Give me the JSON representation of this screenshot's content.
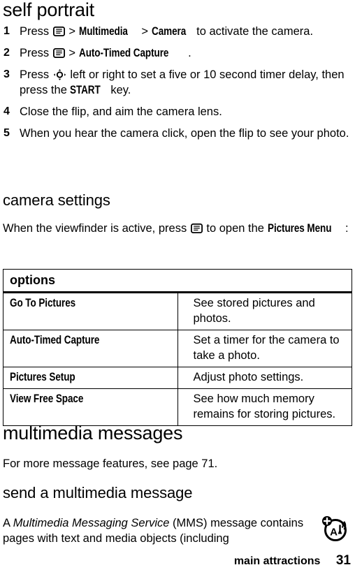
{
  "sections": {
    "self_portrait": {
      "heading": "self portrait",
      "steps": [
        {
          "num": "1",
          "parts": [
            {
              "t": "text",
              "v": "Press "
            },
            {
              "t": "icon",
              "v": "menu-key-icon"
            },
            {
              "t": "text",
              "v": " > "
            },
            {
              "t": "ui",
              "v": "Multimedia"
            },
            {
              "t": "text",
              "v": " > "
            },
            {
              "t": "ui",
              "v": "Camera"
            },
            {
              "t": "text",
              "v": " to activate the camera."
            }
          ]
        },
        {
          "num": "2",
          "parts": [
            {
              "t": "text",
              "v": "Press "
            },
            {
              "t": "icon",
              "v": "menu-key-icon"
            },
            {
              "t": "text",
              "v": " > "
            },
            {
              "t": "ui",
              "v": "Auto-Timed Capture"
            },
            {
              "t": "text",
              "v": "."
            }
          ]
        },
        {
          "num": "3",
          "parts": [
            {
              "t": "text",
              "v": "Press "
            },
            {
              "t": "navicon",
              "v": "navigation-key-icon"
            },
            {
              "t": "text",
              "v": " left or right to set a five or 10 second timer delay, then press the "
            },
            {
              "t": "ui",
              "v": "START"
            },
            {
              "t": "text",
              "v": " key."
            }
          ]
        },
        {
          "num": "4",
          "parts": [
            {
              "t": "text",
              "v": "Close the flip, and aim the camera lens."
            }
          ]
        },
        {
          "num": "5",
          "parts": [
            {
              "t": "text",
              "v": "When you hear the camera click, open the flip to see your photo."
            }
          ]
        }
      ]
    },
    "camera_settings": {
      "heading": "camera settings",
      "intro": [
        {
          "t": "text",
          "v": "When the viewfinder is active, press "
        },
        {
          "t": "icon",
          "v": "menu-key-icon"
        },
        {
          "t": "text",
          "v": " to open the "
        },
        {
          "t": "ui",
          "v": "Pictures Menu"
        },
        {
          "t": "text",
          "v": ":"
        }
      ],
      "table": {
        "header": "options",
        "rows": [
          {
            "option": "Go To Pictures",
            "description": "See stored pictures and photos."
          },
          {
            "option": "Auto-Timed Capture",
            "description": "Set a timer for the camera to take a photo."
          },
          {
            "option": "Pictures Setup",
            "description": "Adjust photo settings."
          },
          {
            "option": "View Free Space",
            "description": "See how much memory remains for storing pictures."
          }
        ]
      }
    },
    "multimedia_messages": {
      "heading": "multimedia messages",
      "intro": "For more message features, see page 71."
    },
    "send_multimedia_message": {
      "heading": "send a multimedia message",
      "body": [
        {
          "t": "text",
          "v": "A "
        },
        {
          "t": "italic",
          "v": "Multimedia Messaging Service"
        },
        {
          "t": "text",
          "v": " (MMS) message contains pages with text and media objects (including"
        }
      ]
    }
  },
  "footer": {
    "label": "main attractions",
    "page": "31",
    "logo_icon": "mms-attachment-icon"
  }
}
